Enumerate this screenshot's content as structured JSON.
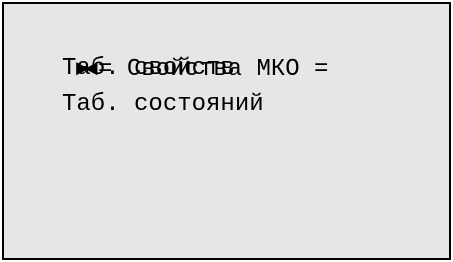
{
  "screen": {
    "cursor": "►◄",
    "title": "= Свойства МКО =",
    "menu_items": [
      {
        "label": "Таб. свойств"
      },
      {
        "label": "Таб. состояний"
      }
    ]
  },
  "colors": {
    "background": "#e6e6e6",
    "border": "#000000",
    "text": "#000000"
  }
}
